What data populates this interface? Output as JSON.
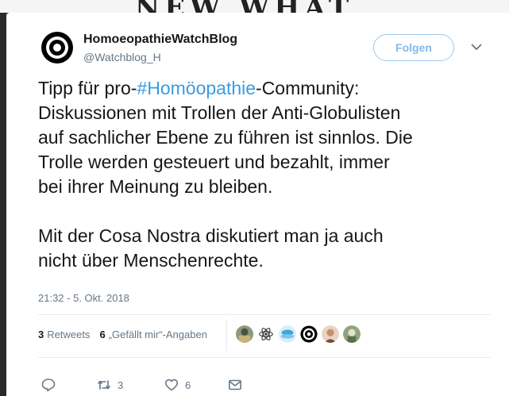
{
  "account": {
    "name": "HomoeopathieWatchBlog",
    "handle": "@Watchblog_H",
    "follow_label": "Folgen"
  },
  "tweet": {
    "line1_prefix": "Tipp für pro-",
    "hashtag": "#Homöopathie",
    "line1_suffix": "-Community:",
    "body": "Diskussionen mit Trollen der Anti-Globulisten\nauf sachlicher Ebene zu führen ist sinnlos. Die\nTrolle werden gesteuert und bezahlt, immer\nbei ihrer Meinung zu bleiben.\n\nMit der Cosa Nostra diskutiert man ja auch\nnicht über Menschenrechte.",
    "timestamp": "21:32 - 5. Okt. 2018"
  },
  "stats": {
    "retweets_count": "3",
    "retweets_label": "Retweets",
    "likes_count": "6",
    "likes_label": "„Gefällt mir“-Angaben"
  },
  "actions": {
    "reply_icon": "reply-icon",
    "retweet_icon": "retweet-icon",
    "retweet_count": "3",
    "like_icon": "heart-icon",
    "like_count": "6",
    "dm_icon": "envelope-icon"
  },
  "colors": {
    "hashtag": "#3a9be0",
    "follow_border": "#9bc9ef",
    "muted": "#657786"
  }
}
